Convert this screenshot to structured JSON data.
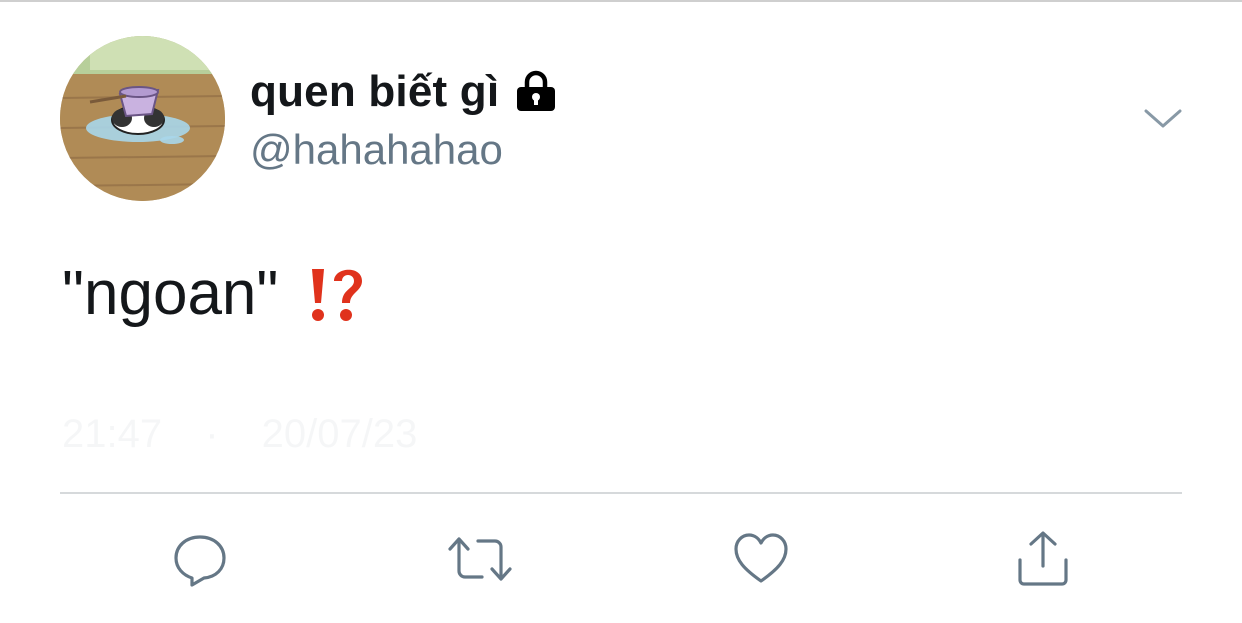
{
  "tweet": {
    "author": {
      "display_name": "quen biết gì",
      "handle": "@hahahahao",
      "protected": true,
      "avatar": "avatar-image"
    },
    "text": "\"ngoan\"",
    "emoji": "⁉️",
    "timestamp": "21:47 · 20/07/23"
  },
  "icons": {
    "lock": "lock-icon",
    "more": "chevron-down-icon",
    "reply": "reply-icon",
    "retweet": "retweet-icon",
    "like": "heart-icon",
    "share": "share-icon"
  },
  "colors": {
    "text_primary": "#14171a",
    "text_secondary": "#657786",
    "icon_gray": "#657786",
    "divider": "#d6d9db",
    "emoji_red": "#e0321c"
  }
}
